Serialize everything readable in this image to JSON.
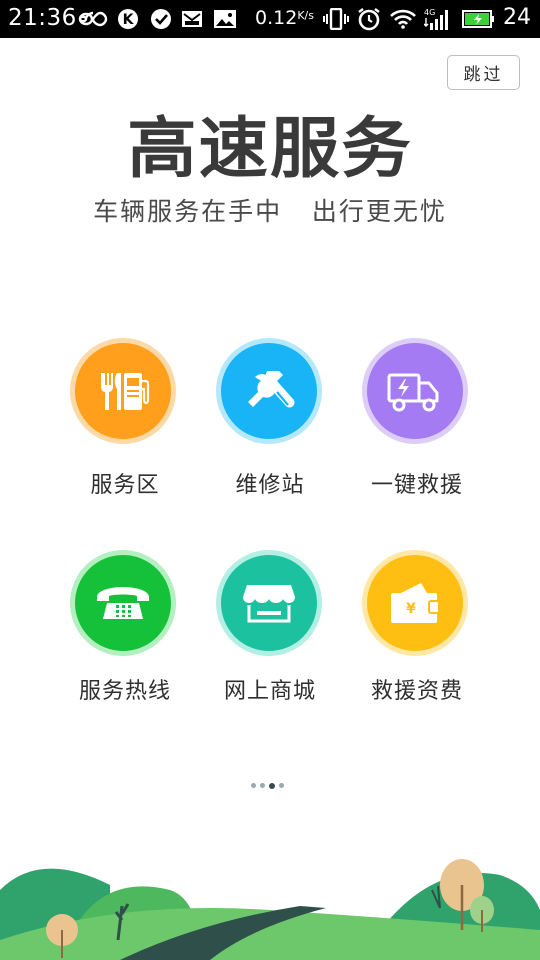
{
  "status_bar": {
    "time": "21:36",
    "net_speed": "0.12",
    "net_speed_unit": "K/s",
    "battery_level": "24",
    "network_type": "4G",
    "icons": [
      "infinity-icon",
      "k-icon",
      "check-icon",
      "mail-icon",
      "image-icon",
      "vibrate-icon",
      "alarm-icon",
      "wifi-icon",
      "signal-icon",
      "battery-icon"
    ]
  },
  "skip_button": {
    "label": "跳过"
  },
  "header": {
    "title": "高速服务",
    "subtitle": "车辆服务在手中   出行更无忧"
  },
  "services": [
    {
      "label": "服务区",
      "icon": "service-area-icon",
      "color": "#FF9F1C",
      "ring": "#FDD9A8"
    },
    {
      "label": "维修站",
      "icon": "repair-tools-icon",
      "color": "#18B4F5",
      "ring": "#B5E8FB"
    },
    {
      "label": "一键救援",
      "icon": "rescue-truck-icon",
      "color": "#A47BF2",
      "ring": "#DCCDF9"
    },
    {
      "label": "服务热线",
      "icon": "telephone-icon",
      "color": "#16C13A",
      "ring": "#B3EFC0"
    },
    {
      "label": "网上商城",
      "icon": "shop-icon",
      "color": "#1CC2A0",
      "ring": "#B4EFE3"
    },
    {
      "label": "救援资费",
      "icon": "wallet-yen-icon",
      "color": "#FFBF12",
      "ring": "#FFE7A6"
    }
  ],
  "pager": {
    "count": 4,
    "active_index": 2
  },
  "colors": {
    "hill_dark": "#2FA36B",
    "hill_light": "#6CC86A",
    "road": "#2E4F4A",
    "tree_tan": "#E9C48F"
  }
}
